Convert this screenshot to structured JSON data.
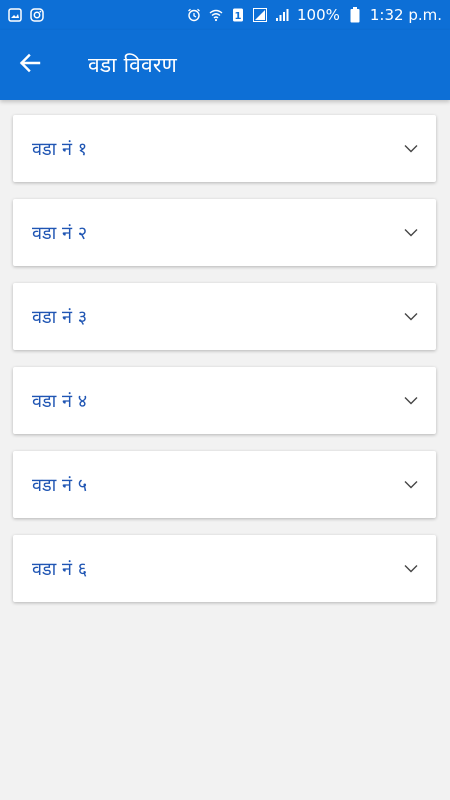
{
  "status_bar": {
    "battery_text": "100%",
    "time": "1:32 p.m.",
    "sim_label": "1"
  },
  "app_bar": {
    "title": "वडा विवरण"
  },
  "wards": [
    {
      "label": "वडा नं १"
    },
    {
      "label": "वडा नं २"
    },
    {
      "label": "वडा नं ३"
    },
    {
      "label": "वडा नं ४"
    },
    {
      "label": "वडा नं ५"
    },
    {
      "label": "वडा नं ६"
    }
  ],
  "colors": {
    "primary": "#0d6fd6",
    "label_text": "#1f55b3",
    "background": "#f2f2f2"
  }
}
